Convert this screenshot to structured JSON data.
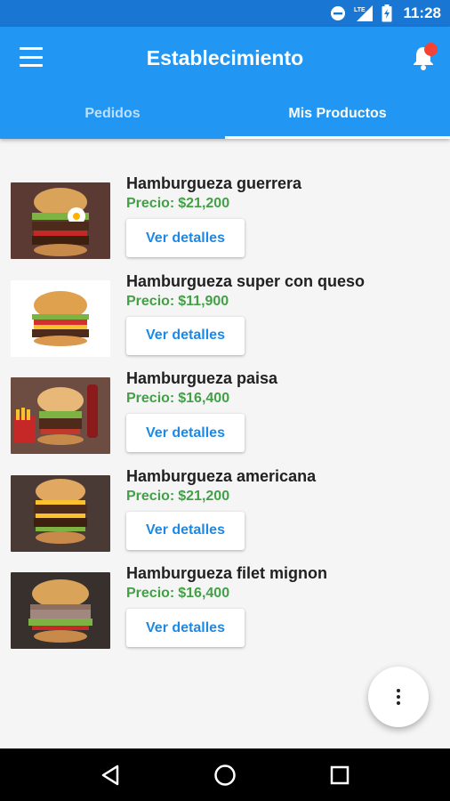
{
  "status_bar": {
    "time": "11:28",
    "network": "LTE"
  },
  "app_bar": {
    "title": "Establecimiento"
  },
  "tabs": [
    {
      "label": "Pedidos",
      "active": false
    },
    {
      "label": "Mis Productos",
      "active": true
    }
  ],
  "products": [
    {
      "name": "Hamburgueza guerrera",
      "price_label": "Precio:",
      "price": "$21,200",
      "button": "Ver detalles"
    },
    {
      "name": "Hamburgueza super con queso",
      "price_label": "Precio:",
      "price": "$11,900",
      "button": "Ver detalles"
    },
    {
      "name": "Hamburgueza paisa",
      "price_label": "Precio:",
      "price": "$16,400",
      "button": "Ver detalles"
    },
    {
      "name": "Hamburgueza americana",
      "price_label": "Precio:",
      "price": "$21,200",
      "button": "Ver detalles"
    },
    {
      "name": "Hamburgueza filet mignon",
      "price_label": "Precio:",
      "price": "$16,400",
      "button": "Ver detalles"
    }
  ],
  "icons": {
    "menu": "menu-icon",
    "notifications": "bell-icon",
    "more": "more-vert-icon",
    "back": "back-triangle-icon",
    "home": "home-circle-icon",
    "recents": "recents-square-icon"
  },
  "colors": {
    "primary": "#2196f3",
    "primary_dark": "#1976d2",
    "price": "#43a047",
    "button_text": "#1e88e5",
    "notification_dot": "#f44336"
  }
}
